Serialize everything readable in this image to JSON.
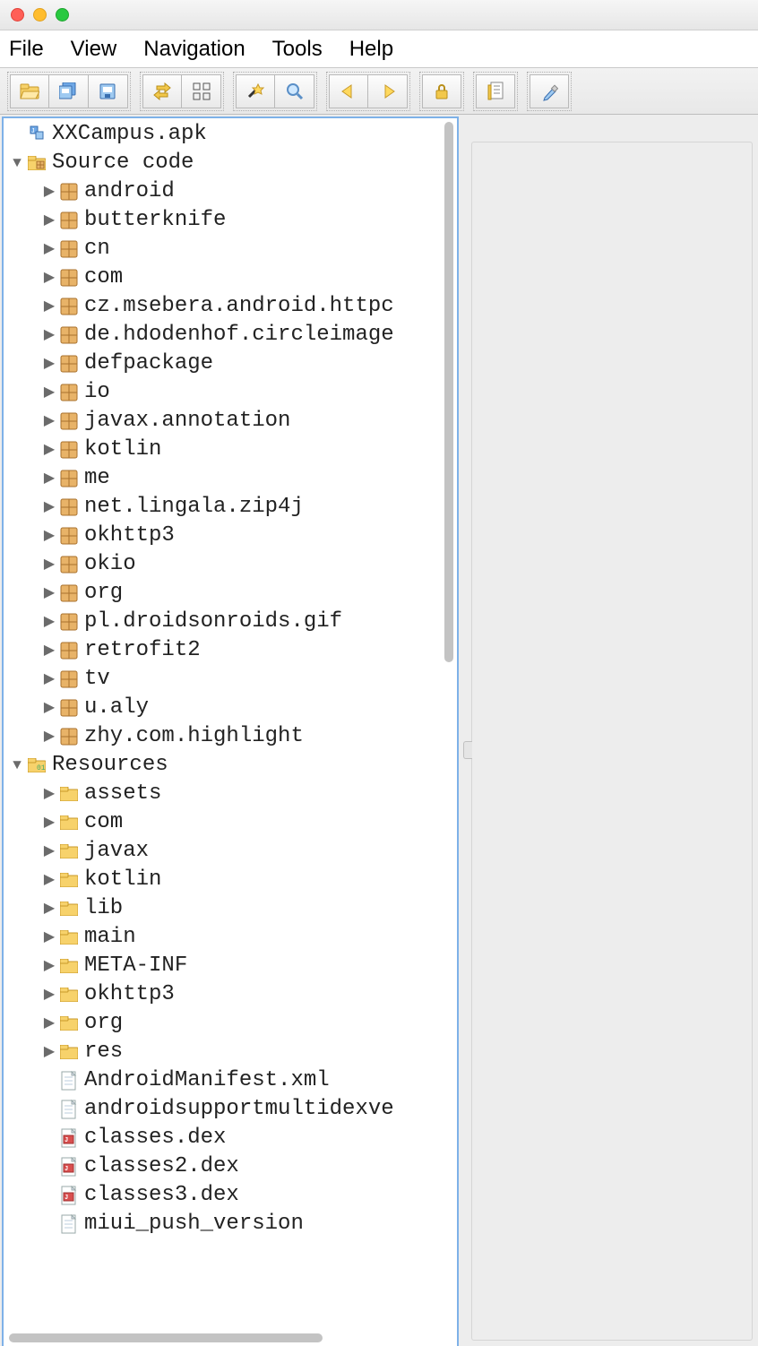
{
  "menubar": {
    "file": "File",
    "view": "View",
    "navigation": "Navigation",
    "tools": "Tools",
    "help": "Help"
  },
  "toolbar": {
    "open": "open-file",
    "saveall": "save-all",
    "save": "save",
    "sync": "sync",
    "flat": "flat-packages",
    "wand": "deobfuscate",
    "search": "search",
    "back": "back",
    "forward": "forward",
    "lock": "lock",
    "log": "log",
    "prefs": "preferences"
  },
  "tree": {
    "root": {
      "label": "XXCampus.apk",
      "icon": "apk"
    },
    "source": {
      "label": "Source code",
      "icon": "source-folder",
      "children": [
        {
          "label": "android"
        },
        {
          "label": "butterknife"
        },
        {
          "label": "cn"
        },
        {
          "label": "com"
        },
        {
          "label": "cz.msebera.android.httpc"
        },
        {
          "label": "de.hdodenhof.circleimage"
        },
        {
          "label": "defpackage"
        },
        {
          "label": "io"
        },
        {
          "label": "javax.annotation"
        },
        {
          "label": "kotlin"
        },
        {
          "label": "me"
        },
        {
          "label": "net.lingala.zip4j"
        },
        {
          "label": "okhttp3"
        },
        {
          "label": "okio"
        },
        {
          "label": "org"
        },
        {
          "label": "pl.droidsonroids.gif"
        },
        {
          "label": "retrofit2"
        },
        {
          "label": "tv"
        },
        {
          "label": "u.aly"
        },
        {
          "label": "zhy.com.highlight"
        }
      ]
    },
    "resources": {
      "label": "Resources",
      "icon": "res-folder",
      "folders": [
        {
          "label": "assets"
        },
        {
          "label": "com"
        },
        {
          "label": "javax"
        },
        {
          "label": "kotlin"
        },
        {
          "label": "lib"
        },
        {
          "label": "main"
        },
        {
          "label": "META-INF"
        },
        {
          "label": "okhttp3"
        },
        {
          "label": "org"
        },
        {
          "label": "res"
        }
      ],
      "files": [
        {
          "label": "AndroidManifest.xml",
          "icon": "xml"
        },
        {
          "label": "androidsupportmultidexve",
          "icon": "xml"
        },
        {
          "label": "classes.dex",
          "icon": "dex"
        },
        {
          "label": "classes2.dex",
          "icon": "dex"
        },
        {
          "label": "classes3.dex",
          "icon": "dex"
        },
        {
          "label": "miui_push_version",
          "icon": "xml"
        }
      ]
    }
  }
}
